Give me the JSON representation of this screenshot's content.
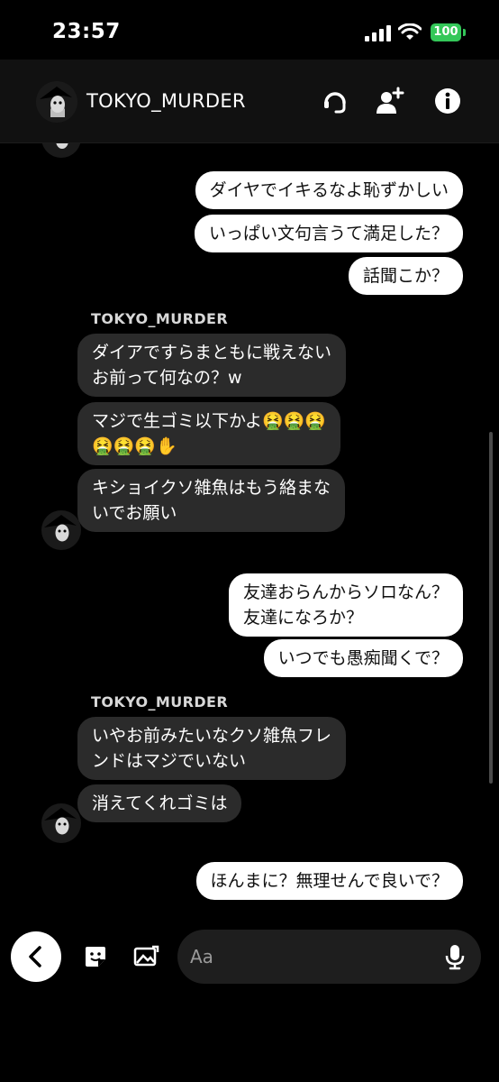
{
  "status": {
    "time": "23:57",
    "battery": "100"
  },
  "header": {
    "title": "TOKYO_MURDER",
    "icons": [
      "headset-icon",
      "add-friend-icon",
      "info-icon"
    ]
  },
  "messages": [
    {
      "dir": "out",
      "text": "ダイヤでイキるなよ恥ずかしい"
    },
    {
      "dir": "out",
      "text": "いっぱい文句言うて満足した？"
    },
    {
      "dir": "out",
      "text": "話聞こか？"
    },
    {
      "dir": "in",
      "sender": "TOKYO_MURDER",
      "lines": [
        "ダイアですらまともに戦えない",
        "お前って何なの？w"
      ]
    },
    {
      "dir": "in",
      "lines": [
        "マジで生ゴミ以下かよ🤮🤮🤮",
        "🤮🤮🤮✋"
      ]
    },
    {
      "dir": "in",
      "lines": [
        "キショイクソ雑魚はもう絡まな",
        "いでお願い"
      ]
    },
    {
      "dir": "out",
      "lines": [
        "友達おらんからソロなん？",
        "友達になろか？"
      ]
    },
    {
      "dir": "out",
      "text": "いつでも愚痴聞くで？"
    },
    {
      "dir": "in",
      "sender": "TOKYO_MURDER",
      "lines": [
        "いやお前みたいなクソ雑魚フレ",
        "ンドはマジでいない"
      ]
    },
    {
      "dir": "in",
      "text": "消えてくれゴミは"
    },
    {
      "dir": "out",
      "text": "ほんまに？無理せんで良いで？"
    }
  ],
  "composer": {
    "placeholder": "Aa",
    "icons": [
      "back-icon",
      "sticker-icon",
      "image-icon",
      "mic-icon"
    ]
  },
  "colors": {
    "outgoing_bubble": "#ffffff",
    "incoming_bubble": "#2b2b2b",
    "battery": "#34c759"
  }
}
